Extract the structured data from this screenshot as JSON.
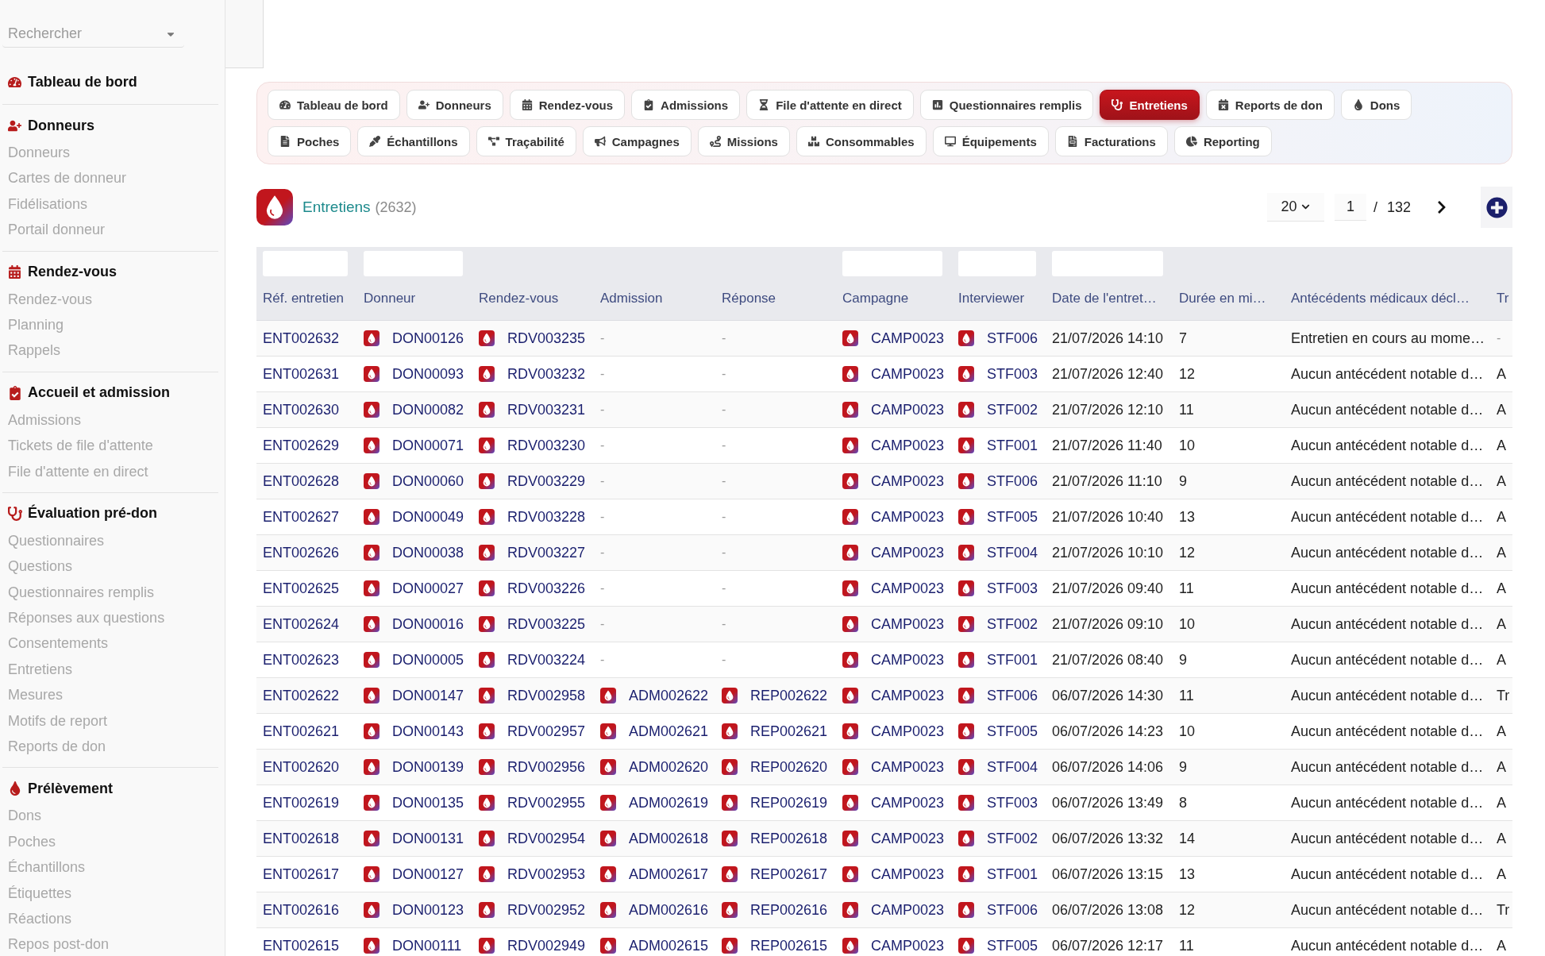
{
  "sidebar": {
    "search": {
      "placeholder": "Rechercher"
    },
    "sections": [
      {
        "title": "Tableau de bord"
      },
      {
        "title": "Donneurs",
        "items": [
          "Donneurs",
          "Cartes de donneur",
          "Fidélisations",
          "Portail donneur"
        ]
      },
      {
        "title": "Rendez-vous",
        "items": [
          "Rendez-vous",
          "Planning",
          "Rappels"
        ]
      },
      {
        "title": "Accueil et admission",
        "items": [
          "Admissions",
          "Tickets de file d'attente",
          "File d'attente en direct"
        ]
      },
      {
        "title": "Évaluation pré-don",
        "items": [
          "Questionnaires",
          "Questions",
          "Questionnaires remplis",
          "Réponses aux questions",
          "Consentements",
          "Entretiens",
          "Mesures",
          "Motifs de report",
          "Reports de don"
        ]
      },
      {
        "title": "Prélèvement",
        "items": [
          "Dons",
          "Poches",
          "Échantillons",
          "Étiquettes",
          "Réactions",
          "Repos post-don"
        ]
      }
    ]
  },
  "tab_rows": [
    [
      {
        "label": "Tableau de bord",
        "selected": false
      },
      {
        "label": "Donneurs",
        "selected": false
      },
      {
        "label": "Rendez-vous",
        "selected": false
      },
      {
        "label": "Admissions",
        "selected": false
      },
      {
        "label": "File d'attente en direct",
        "selected": false
      },
      {
        "label": "Questionnaires remplis",
        "selected": false
      },
      {
        "label": "Entretiens",
        "selected": true
      },
      {
        "label": "Reports de don",
        "selected": false
      },
      {
        "label": "Dons",
        "selected": false
      }
    ],
    [
      {
        "label": "Poches",
        "selected": false
      },
      {
        "label": "Échantillons",
        "selected": false
      },
      {
        "label": "Traçabilité",
        "selected": false
      },
      {
        "label": "Campagnes",
        "selected": false
      },
      {
        "label": "Missions",
        "selected": false
      },
      {
        "label": "Consommables",
        "selected": false
      },
      {
        "label": "Équipements",
        "selected": false
      },
      {
        "label": "Facturations",
        "selected": false
      },
      {
        "label": "Reporting",
        "selected": false
      }
    ]
  ],
  "header": {
    "title": "Entretiens",
    "count": "(2632)"
  },
  "pagination": {
    "page_size": "20",
    "page": "1",
    "separator": "/",
    "page_count": "132"
  },
  "table": {
    "columns": [
      {
        "label": "Réf. entretien",
        "filter": true
      },
      {
        "label": "Donneur",
        "filter": true
      },
      {
        "label": "Rendez-vous",
        "filter": false
      },
      {
        "label": "Admission",
        "filter": false
      },
      {
        "label": "Réponse",
        "filter": false
      },
      {
        "label": "Campagne",
        "filter": true
      },
      {
        "label": "Interviewer",
        "filter": true
      },
      {
        "label": "Date de l'entret…",
        "filter": true
      },
      {
        "label": "Durée en mi…",
        "filter": false
      },
      {
        "label": "Antécédents médicaux décl…",
        "filter": false
      },
      {
        "label": "Tr",
        "filter": false
      }
    ],
    "rows": [
      {
        "cells": [
          {
            "text": "ENT002632",
            "kind": "link"
          },
          {
            "text": "DON00126",
            "kind": "record"
          },
          {
            "text": "RDV003235",
            "kind": "record"
          },
          {
            "text": "-",
            "kind": "none"
          },
          {
            "text": "-",
            "kind": "none"
          },
          {
            "text": "CAMP0023",
            "kind": "record"
          },
          {
            "text": "STF006",
            "kind": "record"
          },
          {
            "text": "21/07/2026 14:10",
            "kind": "text"
          },
          {
            "text": "7",
            "kind": "text"
          },
          {
            "text": "Entretien en cours au mome…",
            "kind": "text"
          },
          {
            "text": "-",
            "kind": "none"
          }
        ]
      },
      {
        "cells": [
          {
            "text": "ENT002631",
            "kind": "link"
          },
          {
            "text": "DON00093",
            "kind": "record"
          },
          {
            "text": "RDV003232",
            "kind": "record"
          },
          {
            "text": "-",
            "kind": "none"
          },
          {
            "text": "-",
            "kind": "none"
          },
          {
            "text": "CAMP0023",
            "kind": "record"
          },
          {
            "text": "STF003",
            "kind": "record"
          },
          {
            "text": "21/07/2026 12:40",
            "kind": "text"
          },
          {
            "text": "12",
            "kind": "text"
          },
          {
            "text": "Aucun antécédent notable d…",
            "kind": "text"
          },
          {
            "text": "A",
            "kind": "text"
          }
        ]
      },
      {
        "cells": [
          {
            "text": "ENT002630",
            "kind": "link"
          },
          {
            "text": "DON00082",
            "kind": "record"
          },
          {
            "text": "RDV003231",
            "kind": "record"
          },
          {
            "text": "-",
            "kind": "none"
          },
          {
            "text": "-",
            "kind": "none"
          },
          {
            "text": "CAMP0023",
            "kind": "record"
          },
          {
            "text": "STF002",
            "kind": "record"
          },
          {
            "text": "21/07/2026 12:10",
            "kind": "text"
          },
          {
            "text": "11",
            "kind": "text"
          },
          {
            "text": "Aucun antécédent notable d…",
            "kind": "text"
          },
          {
            "text": "A",
            "kind": "text"
          }
        ]
      },
      {
        "cells": [
          {
            "text": "ENT002629",
            "kind": "link"
          },
          {
            "text": "DON00071",
            "kind": "record"
          },
          {
            "text": "RDV003230",
            "kind": "record"
          },
          {
            "text": "-",
            "kind": "none"
          },
          {
            "text": "-",
            "kind": "none"
          },
          {
            "text": "CAMP0023",
            "kind": "record"
          },
          {
            "text": "STF001",
            "kind": "record"
          },
          {
            "text": "21/07/2026 11:40",
            "kind": "text"
          },
          {
            "text": "10",
            "kind": "text"
          },
          {
            "text": "Aucun antécédent notable d…",
            "kind": "text"
          },
          {
            "text": "A",
            "kind": "text"
          }
        ]
      },
      {
        "cells": [
          {
            "text": "ENT002628",
            "kind": "link"
          },
          {
            "text": "DON00060",
            "kind": "record"
          },
          {
            "text": "RDV003229",
            "kind": "record"
          },
          {
            "text": "-",
            "kind": "none"
          },
          {
            "text": "-",
            "kind": "none"
          },
          {
            "text": "CAMP0023",
            "kind": "record"
          },
          {
            "text": "STF006",
            "kind": "record"
          },
          {
            "text": "21/07/2026 11:10",
            "kind": "text"
          },
          {
            "text": "9",
            "kind": "text"
          },
          {
            "text": "Aucun antécédent notable d…",
            "kind": "text"
          },
          {
            "text": "A",
            "kind": "text"
          }
        ]
      },
      {
        "cells": [
          {
            "text": "ENT002627",
            "kind": "link"
          },
          {
            "text": "DON00049",
            "kind": "record"
          },
          {
            "text": "RDV003228",
            "kind": "record"
          },
          {
            "text": "-",
            "kind": "none"
          },
          {
            "text": "-",
            "kind": "none"
          },
          {
            "text": "CAMP0023",
            "kind": "record"
          },
          {
            "text": "STF005",
            "kind": "record"
          },
          {
            "text": "21/07/2026 10:40",
            "kind": "text"
          },
          {
            "text": "13",
            "kind": "text"
          },
          {
            "text": "Aucun antécédent notable d…",
            "kind": "text"
          },
          {
            "text": "A",
            "kind": "text"
          }
        ]
      },
      {
        "cells": [
          {
            "text": "ENT002626",
            "kind": "link"
          },
          {
            "text": "DON00038",
            "kind": "record"
          },
          {
            "text": "RDV003227",
            "kind": "record"
          },
          {
            "text": "-",
            "kind": "none"
          },
          {
            "text": "-",
            "kind": "none"
          },
          {
            "text": "CAMP0023",
            "kind": "record"
          },
          {
            "text": "STF004",
            "kind": "record"
          },
          {
            "text": "21/07/2026 10:10",
            "kind": "text"
          },
          {
            "text": "12",
            "kind": "text"
          },
          {
            "text": "Aucun antécédent notable d…",
            "kind": "text"
          },
          {
            "text": "A",
            "kind": "text"
          }
        ]
      },
      {
        "cells": [
          {
            "text": "ENT002625",
            "kind": "link"
          },
          {
            "text": "DON00027",
            "kind": "record"
          },
          {
            "text": "RDV003226",
            "kind": "record"
          },
          {
            "text": "-",
            "kind": "none"
          },
          {
            "text": "-",
            "kind": "none"
          },
          {
            "text": "CAMP0023",
            "kind": "record"
          },
          {
            "text": "STF003",
            "kind": "record"
          },
          {
            "text": "21/07/2026 09:40",
            "kind": "text"
          },
          {
            "text": "11",
            "kind": "text"
          },
          {
            "text": "Aucun antécédent notable d…",
            "kind": "text"
          },
          {
            "text": "A",
            "kind": "text"
          }
        ]
      },
      {
        "cells": [
          {
            "text": "ENT002624",
            "kind": "link"
          },
          {
            "text": "DON00016",
            "kind": "record"
          },
          {
            "text": "RDV003225",
            "kind": "record"
          },
          {
            "text": "-",
            "kind": "none"
          },
          {
            "text": "-",
            "kind": "none"
          },
          {
            "text": "CAMP0023",
            "kind": "record"
          },
          {
            "text": "STF002",
            "kind": "record"
          },
          {
            "text": "21/07/2026 09:10",
            "kind": "text"
          },
          {
            "text": "10",
            "kind": "text"
          },
          {
            "text": "Aucun antécédent notable d…",
            "kind": "text"
          },
          {
            "text": "A",
            "kind": "text"
          }
        ]
      },
      {
        "cells": [
          {
            "text": "ENT002623",
            "kind": "link"
          },
          {
            "text": "DON00005",
            "kind": "record"
          },
          {
            "text": "RDV003224",
            "kind": "record"
          },
          {
            "text": "-",
            "kind": "none"
          },
          {
            "text": "-",
            "kind": "none"
          },
          {
            "text": "CAMP0023",
            "kind": "record"
          },
          {
            "text": "STF001",
            "kind": "record"
          },
          {
            "text": "21/07/2026 08:40",
            "kind": "text"
          },
          {
            "text": "9",
            "kind": "text"
          },
          {
            "text": "Aucun antécédent notable d…",
            "kind": "text"
          },
          {
            "text": "A",
            "kind": "text"
          }
        ]
      },
      {
        "cells": [
          {
            "text": "ENT002622",
            "kind": "link"
          },
          {
            "text": "DON00147",
            "kind": "record"
          },
          {
            "text": "RDV002958",
            "kind": "record"
          },
          {
            "text": "ADM002622",
            "kind": "record"
          },
          {
            "text": "REP002622",
            "kind": "record"
          },
          {
            "text": "CAMP0023",
            "kind": "record"
          },
          {
            "text": "STF006",
            "kind": "record"
          },
          {
            "text": "06/07/2026 14:30",
            "kind": "text"
          },
          {
            "text": "11",
            "kind": "text"
          },
          {
            "text": "Aucun antécédent notable d…",
            "kind": "text"
          },
          {
            "text": "Tr",
            "kind": "text"
          }
        ]
      },
      {
        "cells": [
          {
            "text": "ENT002621",
            "kind": "link"
          },
          {
            "text": "DON00143",
            "kind": "record"
          },
          {
            "text": "RDV002957",
            "kind": "record"
          },
          {
            "text": "ADM002621",
            "kind": "record"
          },
          {
            "text": "REP002621",
            "kind": "record"
          },
          {
            "text": "CAMP0023",
            "kind": "record"
          },
          {
            "text": "STF005",
            "kind": "record"
          },
          {
            "text": "06/07/2026 14:23",
            "kind": "text"
          },
          {
            "text": "10",
            "kind": "text"
          },
          {
            "text": "Aucun antécédent notable d…",
            "kind": "text"
          },
          {
            "text": "A",
            "kind": "text"
          }
        ]
      },
      {
        "cells": [
          {
            "text": "ENT002620",
            "kind": "link"
          },
          {
            "text": "DON00139",
            "kind": "record"
          },
          {
            "text": "RDV002956",
            "kind": "record"
          },
          {
            "text": "ADM002620",
            "kind": "record"
          },
          {
            "text": "REP002620",
            "kind": "record"
          },
          {
            "text": "CAMP0023",
            "kind": "record"
          },
          {
            "text": "STF004",
            "kind": "record"
          },
          {
            "text": "06/07/2026 14:06",
            "kind": "text"
          },
          {
            "text": "9",
            "kind": "text"
          },
          {
            "text": "Aucun antécédent notable d…",
            "kind": "text"
          },
          {
            "text": "A",
            "kind": "text"
          }
        ]
      },
      {
        "cells": [
          {
            "text": "ENT002619",
            "kind": "link"
          },
          {
            "text": "DON00135",
            "kind": "record"
          },
          {
            "text": "RDV002955",
            "kind": "record"
          },
          {
            "text": "ADM002619",
            "kind": "record"
          },
          {
            "text": "REP002619",
            "kind": "record"
          },
          {
            "text": "CAMP0023",
            "kind": "record"
          },
          {
            "text": "STF003",
            "kind": "record"
          },
          {
            "text": "06/07/2026 13:49",
            "kind": "text"
          },
          {
            "text": "8",
            "kind": "text"
          },
          {
            "text": "Aucun antécédent notable d…",
            "kind": "text"
          },
          {
            "text": "A",
            "kind": "text"
          }
        ]
      },
      {
        "cells": [
          {
            "text": "ENT002618",
            "kind": "link"
          },
          {
            "text": "DON00131",
            "kind": "record"
          },
          {
            "text": "RDV002954",
            "kind": "record"
          },
          {
            "text": "ADM002618",
            "kind": "record"
          },
          {
            "text": "REP002618",
            "kind": "record"
          },
          {
            "text": "CAMP0023",
            "kind": "record"
          },
          {
            "text": "STF002",
            "kind": "record"
          },
          {
            "text": "06/07/2026 13:32",
            "kind": "text"
          },
          {
            "text": "14",
            "kind": "text"
          },
          {
            "text": "Aucun antécédent notable d…",
            "kind": "text"
          },
          {
            "text": "A",
            "kind": "text"
          }
        ]
      },
      {
        "cells": [
          {
            "text": "ENT002617",
            "kind": "link"
          },
          {
            "text": "DON00127",
            "kind": "record"
          },
          {
            "text": "RDV002953",
            "kind": "record"
          },
          {
            "text": "ADM002617",
            "kind": "record"
          },
          {
            "text": "REP002617",
            "kind": "record"
          },
          {
            "text": "CAMP0023",
            "kind": "record"
          },
          {
            "text": "STF001",
            "kind": "record"
          },
          {
            "text": "06/07/2026 13:15",
            "kind": "text"
          },
          {
            "text": "13",
            "kind": "text"
          },
          {
            "text": "Aucun antécédent notable d…",
            "kind": "text"
          },
          {
            "text": "A",
            "kind": "text"
          }
        ]
      },
      {
        "cells": [
          {
            "text": "ENT002616",
            "kind": "link"
          },
          {
            "text": "DON00123",
            "kind": "record"
          },
          {
            "text": "RDV002952",
            "kind": "record"
          },
          {
            "text": "ADM002616",
            "kind": "record"
          },
          {
            "text": "REP002616",
            "kind": "record"
          },
          {
            "text": "CAMP0023",
            "kind": "record"
          },
          {
            "text": "STF006",
            "kind": "record"
          },
          {
            "text": "06/07/2026 13:08",
            "kind": "text"
          },
          {
            "text": "12",
            "kind": "text"
          },
          {
            "text": "Aucun antécédent notable d…",
            "kind": "text"
          },
          {
            "text": "Tr",
            "kind": "text"
          }
        ]
      },
      {
        "cells": [
          {
            "text": "ENT002615",
            "kind": "link"
          },
          {
            "text": "DON00111",
            "kind": "record"
          },
          {
            "text": "RDV002949",
            "kind": "record"
          },
          {
            "text": "ADM002615",
            "kind": "record"
          },
          {
            "text": "REP002615",
            "kind": "record"
          },
          {
            "text": "CAMP0023",
            "kind": "record"
          },
          {
            "text": "STF005",
            "kind": "record"
          },
          {
            "text": "06/07/2026 12:17",
            "kind": "text"
          },
          {
            "text": "11",
            "kind": "text"
          },
          {
            "text": "Aucun antécédent notable d…",
            "kind": "text"
          },
          {
            "text": "A",
            "kind": "text"
          }
        ]
      }
    ]
  }
}
